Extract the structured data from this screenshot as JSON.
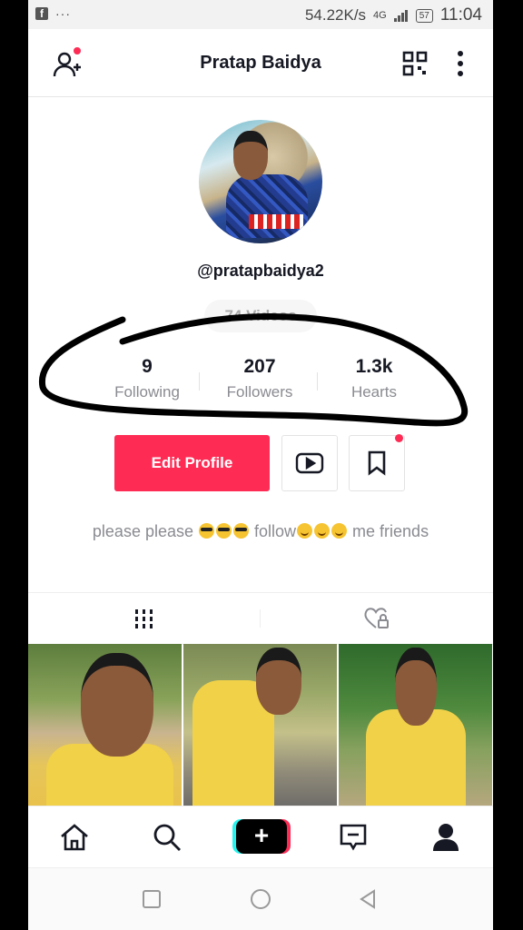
{
  "status_bar": {
    "dots": "···",
    "net_speed": "54.22K/s",
    "signal": "4G",
    "battery": "57",
    "time": "11:04"
  },
  "header": {
    "title": "Pratap Baidya"
  },
  "profile": {
    "username": "@pratapbaidya2",
    "videos": "74 Videos"
  },
  "stats": [
    {
      "value": "9",
      "label": "Following"
    },
    {
      "value": "207",
      "label": "Followers"
    },
    {
      "value": "1.3k",
      "label": "Hearts"
    }
  ],
  "actions": {
    "edit_profile": "Edit Profile"
  },
  "bio": {
    "part1": "please please ",
    "part2": " follow",
    "part3": " me friends"
  },
  "colors": {
    "accent": "#fe2c55",
    "text": "#161823",
    "muted": "#8a8b91",
    "teal": "#25f4ee"
  },
  "icons": {
    "header_left": "add-user-icon",
    "header_right": [
      "qr-code-icon",
      "more-vertical-icon"
    ],
    "tabs": [
      "grid-icon",
      "liked-locked-icon"
    ],
    "bottom_nav": [
      "home-icon",
      "search-icon",
      "create-plus-icon",
      "inbox-icon",
      "profile-icon"
    ],
    "system_nav": [
      "recent-apps-icon",
      "home-circle-icon",
      "back-icon"
    ]
  }
}
